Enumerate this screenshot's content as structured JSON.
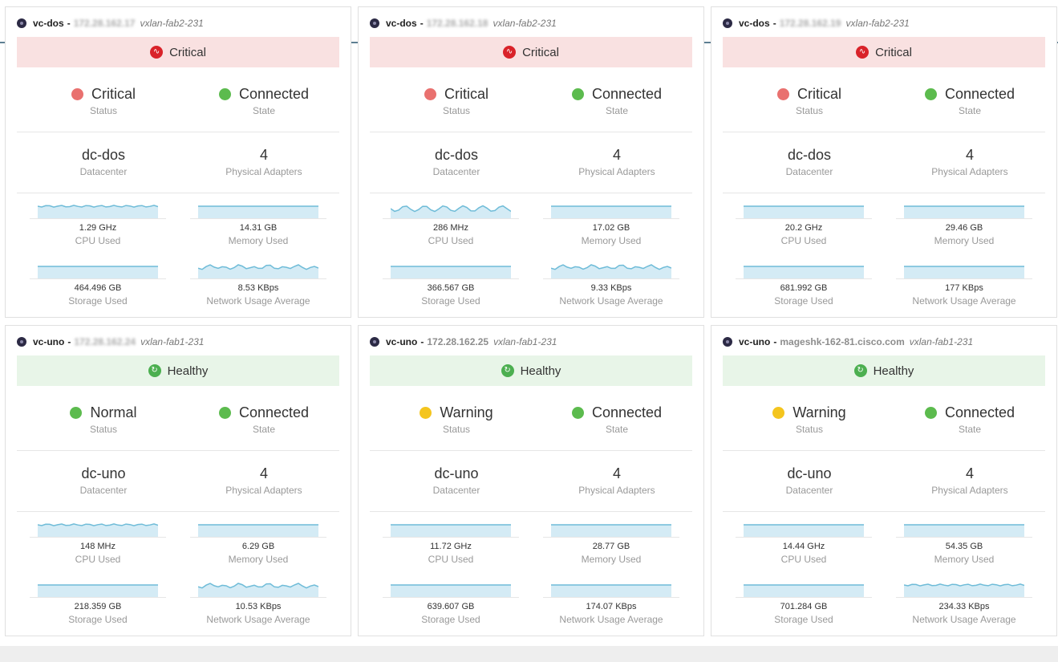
{
  "colors": {
    "critical": "#e9716f",
    "normal": "#5cbb4e",
    "warning": "#f4c51e",
    "connected": "#5cbb4e",
    "spark_line": "#6fbcd8",
    "spark_fill": "#d4ebf5"
  },
  "cards": [
    {
      "name": "vc-dos",
      "sep": "-",
      "host": "172.28.162.17",
      "host_blurred": true,
      "fabric": "vxlan-fab2-231",
      "health": "Critical",
      "health_kind": "critical",
      "health_icon": "pulse-icon",
      "status": "Critical",
      "status_kind": "critical",
      "status_label": "Status",
      "state": "Connected",
      "state_label": "State",
      "datacenter": "dc-dos",
      "datacenter_label": "Datacenter",
      "adapters": "4",
      "adapters_label": "Physical Adapters",
      "metrics": [
        {
          "value": "1.29 GHz",
          "label": "CPU Used",
          "wave": "smallwave"
        },
        {
          "value": "14.31 GB",
          "label": "Memory Used",
          "wave": "flat"
        },
        {
          "value": "464.496 GB",
          "label": "Storage Used",
          "wave": "flat"
        },
        {
          "value": "8.53 KBps",
          "label": "Network Usage Average",
          "wave": "wave"
        }
      ]
    },
    {
      "name": "vc-dos",
      "sep": "-",
      "host": "172.28.162.18",
      "host_blurred": true,
      "fabric": "vxlan-fab2-231",
      "health": "Critical",
      "health_kind": "critical",
      "health_icon": "pulse-icon",
      "status": "Critical",
      "status_kind": "critical",
      "status_label": "Status",
      "state": "Connected",
      "state_label": "State",
      "datacenter": "dc-dos",
      "datacenter_label": "Datacenter",
      "adapters": "4",
      "adapters_label": "Physical Adapters",
      "metrics": [
        {
          "value": "286 MHz",
          "label": "CPU Used",
          "wave": "bigwave"
        },
        {
          "value": "17.02 GB",
          "label": "Memory Used",
          "wave": "flat"
        },
        {
          "value": "366.567 GB",
          "label": "Storage Used",
          "wave": "flat"
        },
        {
          "value": "9.33 KBps",
          "label": "Network Usage Average",
          "wave": "wave"
        }
      ]
    },
    {
      "name": "vc-dos",
      "sep": "-",
      "host": "172.28.162.19",
      "host_blurred": true,
      "fabric": "vxlan-fab2-231",
      "health": "Critical",
      "health_kind": "critical",
      "health_icon": "pulse-icon",
      "status": "Critical",
      "status_kind": "critical",
      "status_label": "Status",
      "state": "Connected",
      "state_label": "State",
      "datacenter": "dc-dos",
      "datacenter_label": "Datacenter",
      "adapters": "4",
      "adapters_label": "Physical Adapters",
      "metrics": [
        {
          "value": "20.2 GHz",
          "label": "CPU Used",
          "wave": "flat"
        },
        {
          "value": "29.46 GB",
          "label": "Memory Used",
          "wave": "flat"
        },
        {
          "value": "681.992 GB",
          "label": "Storage Used",
          "wave": "flat"
        },
        {
          "value": "177 KBps",
          "label": "Network Usage Average",
          "wave": "flat"
        }
      ]
    },
    {
      "name": "vc-uno",
      "sep": "-",
      "host": "172.28.162.24",
      "host_blurred": true,
      "fabric": "vxlan-fab1-231",
      "health": "Healthy",
      "health_kind": "healthy",
      "health_icon": "refresh-icon",
      "status": "Normal",
      "status_kind": "normal",
      "status_label": "Status",
      "state": "Connected",
      "state_label": "State",
      "datacenter": "dc-uno",
      "datacenter_label": "Datacenter",
      "adapters": "4",
      "adapters_label": "Physical Adapters",
      "metrics": [
        {
          "value": "148 MHz",
          "label": "CPU Used",
          "wave": "smallwave"
        },
        {
          "value": "6.29 GB",
          "label": "Memory Used",
          "wave": "flat"
        },
        {
          "value": "218.359 GB",
          "label": "Storage Used",
          "wave": "flat"
        },
        {
          "value": "10.53 KBps",
          "label": "Network Usage Average",
          "wave": "wave"
        }
      ]
    },
    {
      "name": "vc-uno",
      "sep": "-",
      "host": "172.28.162.25",
      "host_blurred": false,
      "fabric": "vxlan-fab1-231",
      "health": "Healthy",
      "health_kind": "healthy",
      "health_icon": "refresh-icon",
      "status": "Warning",
      "status_kind": "warning",
      "status_label": "Status",
      "state": "Connected",
      "state_label": "State",
      "datacenter": "dc-uno",
      "datacenter_label": "Datacenter",
      "adapters": "4",
      "adapters_label": "Physical Adapters",
      "metrics": [
        {
          "value": "11.72 GHz",
          "label": "CPU Used",
          "wave": "flat"
        },
        {
          "value": "28.77 GB",
          "label": "Memory Used",
          "wave": "flat"
        },
        {
          "value": "639.607 GB",
          "label": "Storage Used",
          "wave": "flat"
        },
        {
          "value": "174.07 KBps",
          "label": "Network Usage Average",
          "wave": "flat"
        }
      ]
    },
    {
      "name": "vc-uno",
      "sep": "-",
      "host": "mageshk-162-81.cisco.com",
      "host_blurred": false,
      "fabric": "vxlan-fab1-231",
      "health": "Healthy",
      "health_kind": "healthy",
      "health_icon": "refresh-icon",
      "status": "Warning",
      "status_kind": "warning",
      "status_label": "Status",
      "state": "Connected",
      "state_label": "State",
      "datacenter": "dc-uno",
      "datacenter_label": "Datacenter",
      "adapters": "4",
      "adapters_label": "Physical Adapters",
      "metrics": [
        {
          "value": "14.44 GHz",
          "label": "CPU Used",
          "wave": "flat"
        },
        {
          "value": "54.35 GB",
          "label": "Memory Used",
          "wave": "flat"
        },
        {
          "value": "701.284 GB",
          "label": "Storage Used",
          "wave": "flat"
        },
        {
          "value": "234.33 KBps",
          "label": "Network Usage Average",
          "wave": "smallwave"
        }
      ]
    }
  ]
}
